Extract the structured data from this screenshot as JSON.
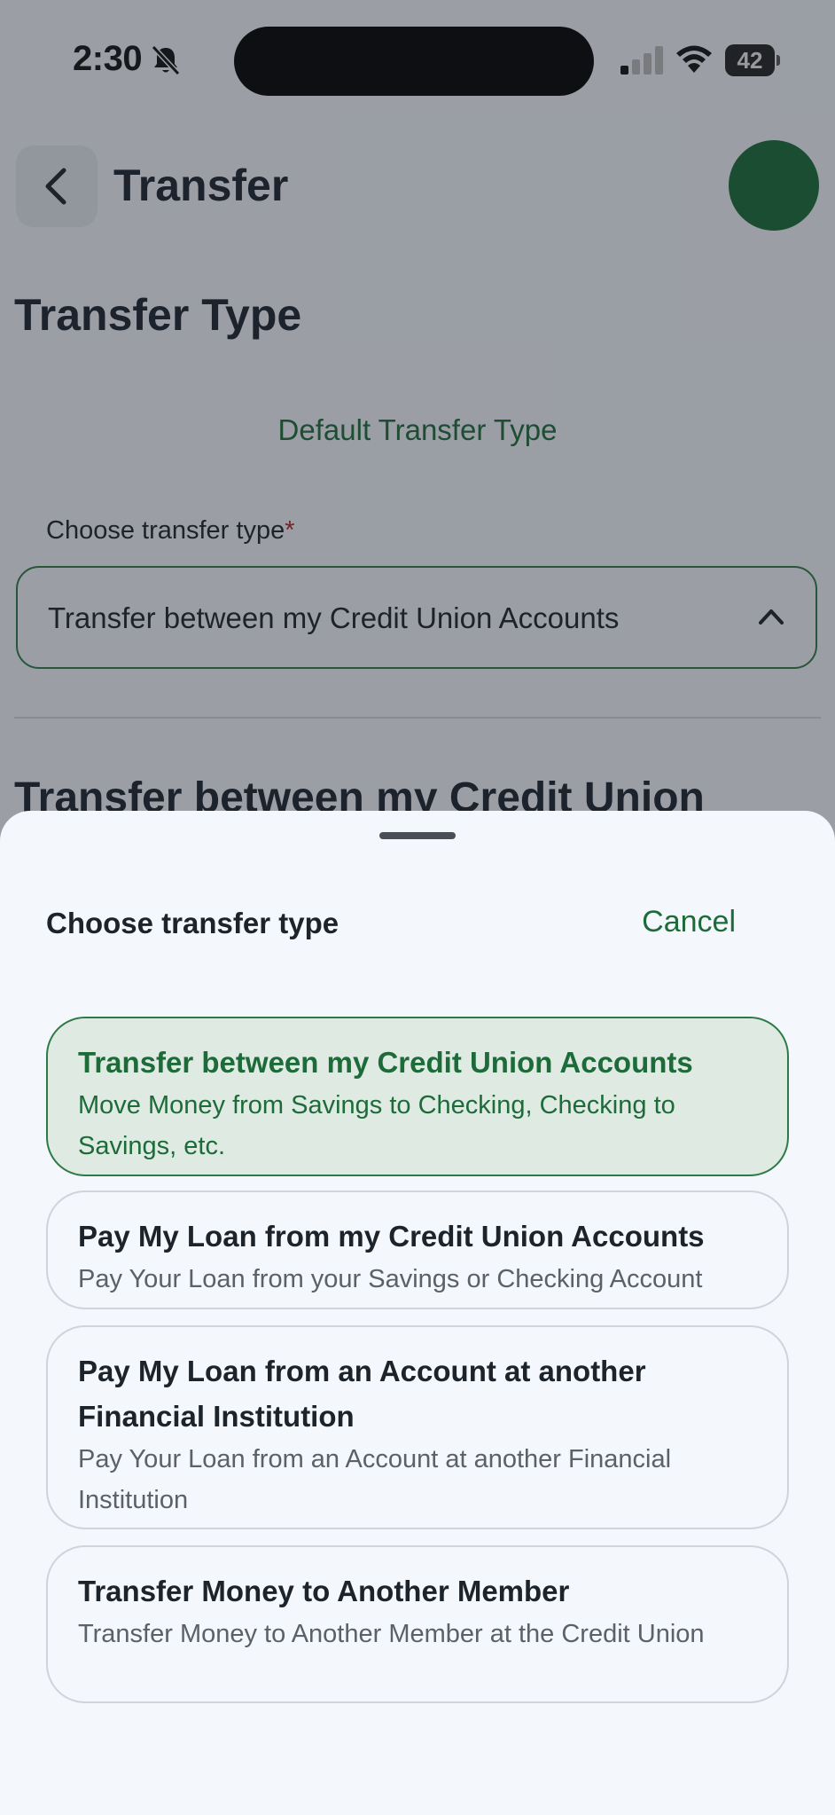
{
  "status_bar": {
    "time": "2:30",
    "battery": "42"
  },
  "header": {
    "title": "Transfer",
    "back_icon": "chevron-left-icon"
  },
  "page": {
    "section_title": "Transfer Type",
    "default_link": "Default Transfer Type",
    "field_label": "Choose transfer type",
    "required_marker": "*",
    "selected_value": "Transfer between my Credit Union Accounts",
    "section2_title": "Transfer between my Credit Union"
  },
  "sheet": {
    "title": "Choose transfer type",
    "cancel_label": "Cancel",
    "options": [
      {
        "title": "Transfer between my Credit Union Accounts",
        "description": "Move Money from Savings to Checking, Checking to Savings, etc.",
        "selected": true
      },
      {
        "title": "Pay My Loan from my Credit Union Accounts",
        "description": "Pay Your Loan from your Savings or Checking Account",
        "selected": false
      },
      {
        "title": "Pay My Loan from an Account at another Financial Institution",
        "description": "Pay Your Loan from an Account at another Financial Institution",
        "selected": false
      },
      {
        "title": "Transfer Money to Another Member",
        "description": "Transfer Money to Another Member at the Credit Union",
        "selected": false
      }
    ]
  },
  "colors": {
    "brand_green": "#1e6b3a",
    "avatar_green": "#176b34",
    "selected_bg": "#dfeae3",
    "required_red": "#b42525"
  }
}
